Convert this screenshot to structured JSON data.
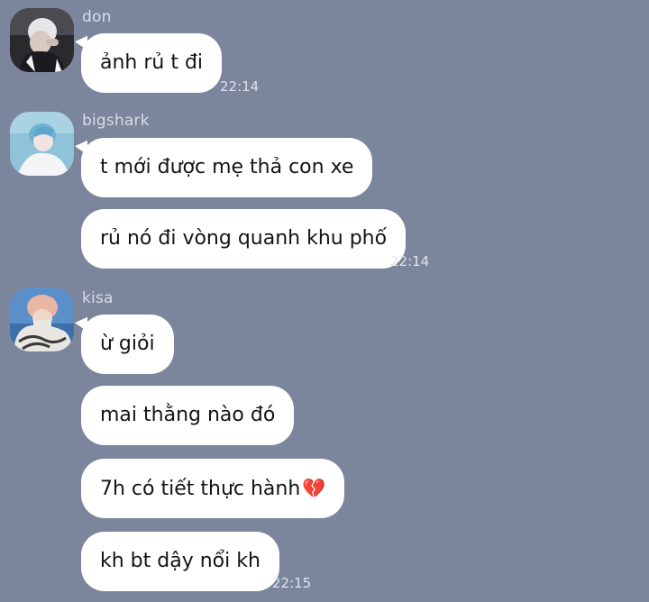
{
  "messages": [
    {
      "sender": "don",
      "avatar_icon": "avatar-don-photo",
      "texts": [
        "ảnh rủ t đi"
      ],
      "time": "22:14"
    },
    {
      "sender": "bigshark",
      "avatar_icon": "avatar-bigshark-photo",
      "texts": [
        "t mới được mẹ thả con xe",
        "rủ nó đi vòng quanh khu phố"
      ],
      "time": "22:14"
    },
    {
      "sender": "kisa",
      "avatar_icon": "avatar-kisa-photo",
      "texts": [
        "ừ giỏi",
        "mai thằng nào đó",
        "7h có tiết thực hành",
        "kh bt dậy nổi kh"
      ],
      "emoji": "💔",
      "time": "22:15"
    }
  ],
  "colors": {
    "background": "#7b869c",
    "bubble": "#ffffff",
    "sender_text": "#d8dde7",
    "time_text": "#dfe3ea"
  }
}
